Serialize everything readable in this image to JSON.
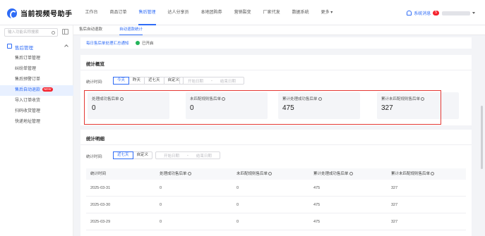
{
  "app": {
    "title": "当前视频号助手",
    "brand_color": "#2f6cf6",
    "alert_color": "#e53935"
  },
  "nav": {
    "items": [
      "工作台",
      "商品订单",
      "售后管理",
      "达人分享员",
      "本地团购券",
      "营销裂变",
      "厂家代发",
      "数据系统",
      "更多"
    ],
    "active_index": 2,
    "message_label": "系统消息",
    "message_badge": "5"
  },
  "sidebar": {
    "search_placeholder": "输入功能名称搜索",
    "group_label": "售后管理",
    "items": [
      {
        "label": "售后订单管理",
        "badge": ""
      },
      {
        "label": "纠纷单管理",
        "badge": ""
      },
      {
        "label": "售后预警订单",
        "badge": ""
      },
      {
        "label": "售后自动退款",
        "badge": "NEW"
      },
      {
        "label": "导入订单收货",
        "badge": ""
      },
      {
        "label": "扫码收货管理",
        "badge": ""
      },
      {
        "label": "快递地址管理",
        "badge": ""
      }
    ],
    "active_index": 3
  },
  "page_tabs": [
    "售后自动退款",
    "自动退款统计"
  ],
  "notice": {
    "text": "每日售后单处理汇总通知",
    "status": "已开启"
  },
  "overview": {
    "title": "统计概览",
    "filter_label": "统计时间:",
    "range_buttons": [
      "今天",
      "昨天",
      "近七天",
      "自定义"
    ],
    "active_range": 0,
    "start_placeholder": "开始日期",
    "end_placeholder": "结束日期",
    "range_separator": "-",
    "stats": [
      {
        "label": "处理成功售后单",
        "value": "0"
      },
      {
        "label": "未匹配规则售后单",
        "value": "0"
      },
      {
        "label": "累计处理成功售后单",
        "value": "475"
      },
      {
        "label": "累计未匹配规则售后单",
        "value": "327"
      }
    ]
  },
  "detail": {
    "title": "统计明细",
    "filter_label": "统计时间:",
    "range_buttons": [
      "近七天",
      "自定义"
    ],
    "active_range": 0,
    "start_placeholder": "开始日期",
    "end_placeholder": "结束日期",
    "range_separator": "-",
    "columns": [
      "统计时间",
      "处理成功售后单",
      "未匹配规则售后单",
      "累计处理成功售后单",
      "累计未匹配规则售后单"
    ],
    "rows": [
      [
        "2025-03-31",
        "0",
        "0",
        "475",
        "327"
      ],
      [
        "2025-03-30",
        "0",
        "0",
        "475",
        "327"
      ],
      [
        "2025-03-29",
        "0",
        "0",
        "475",
        "327"
      ]
    ]
  }
}
